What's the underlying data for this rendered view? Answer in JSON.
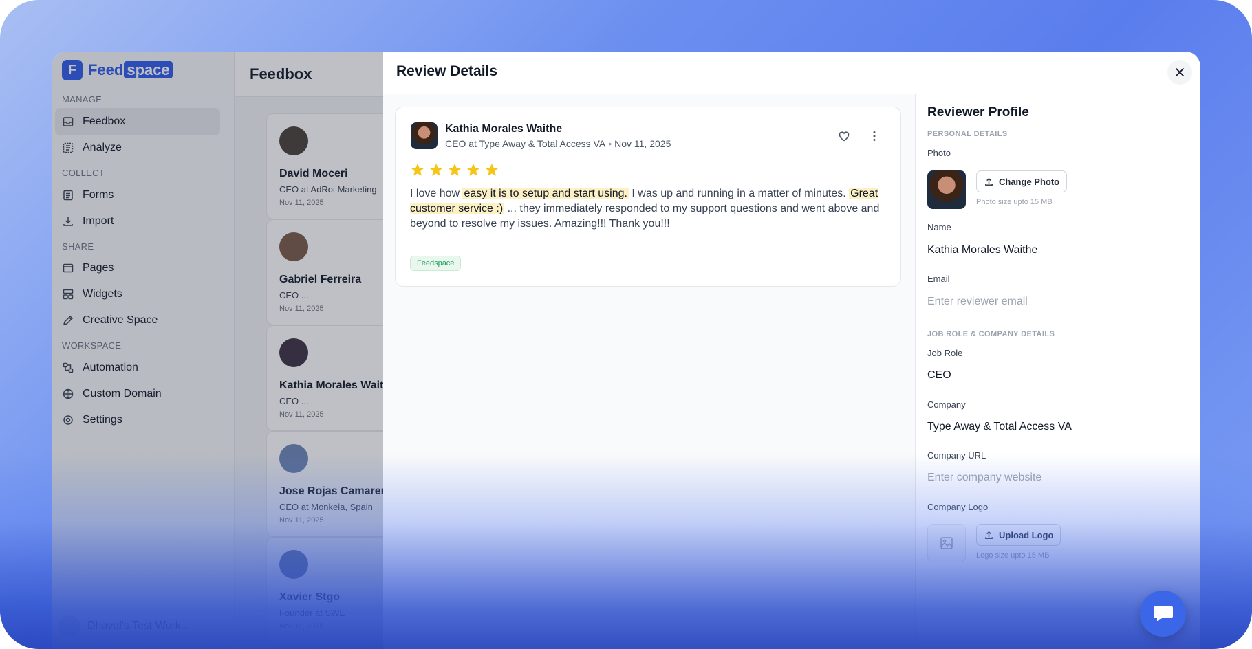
{
  "brand": {
    "logo_letter": "F",
    "name_prefix": "Feed",
    "name_suffix": "space",
    "color": "#2f5bea"
  },
  "sidebar": {
    "sections": [
      {
        "label": "MANAGE",
        "items": [
          {
            "label": "Feedbox",
            "icon": "inbox-icon",
            "active": true
          },
          {
            "label": "Analyze",
            "icon": "analyze-icon"
          }
        ]
      },
      {
        "label": "COLLECT",
        "items": [
          {
            "label": "Forms",
            "icon": "forms-icon"
          },
          {
            "label": "Import",
            "icon": "import-icon"
          }
        ]
      },
      {
        "label": "SHARE",
        "items": [
          {
            "label": "Pages",
            "icon": "pages-icon"
          },
          {
            "label": "Widgets",
            "icon": "widgets-icon"
          },
          {
            "label": "Creative Space",
            "icon": "creative-icon"
          }
        ]
      },
      {
        "label": "WORKSPACE",
        "items": [
          {
            "label": "Automation",
            "icon": "automation-icon"
          },
          {
            "label": "Custom Domain",
            "icon": "globe-icon"
          },
          {
            "label": "Settings",
            "icon": "gear-icon"
          }
        ]
      }
    ],
    "workspace_name": "Dhaval's Test Work..."
  },
  "feedbox": {
    "title": "Feedbox",
    "cards": [
      {
        "name": "David Moceri",
        "role": "CEO at AdRoi Marketing",
        "date": "Nov 11, 2025"
      },
      {
        "name": "Gabriel Ferreira",
        "role": "CEO ...",
        "date": "Nov 11, 2025"
      },
      {
        "name": "Kathia Morales Waithe",
        "role": "CEO ...",
        "date": "Nov 11, 2025"
      },
      {
        "name": "Jose Rojas Camarena",
        "role": "CEO at Monkeia, Spain",
        "date": "Nov 11, 2025"
      },
      {
        "name": "Xavier Stgo",
        "role": "Founder at SWE",
        "date": "Nov 11, 2025"
      }
    ]
  },
  "review": {
    "panel_title": "Review Details",
    "reviewer_name": "Kathia Morales Waithe",
    "reviewer_meta": "CEO at Type Away & Total Access VA",
    "date": "Nov 11, 2025",
    "rating": 5,
    "text_1": "I love how ",
    "highlight_1": "easy it is to setup and start using.",
    "text_2": " I was up and running in a matter of minutes. ",
    "highlight_2": "Great customer service :)",
    "text_3": " ... they immediately responded to my support questions and went above and beyond to resolve my issues. Amazing!!! Thank you!!!",
    "tag": "Feedspace"
  },
  "profile": {
    "title": "Reviewer Profile",
    "personal_section": "PERSONAL DETAILS",
    "photo_label": "Photo",
    "change_photo": "Change Photo",
    "photo_hint": "Photo size upto 15 MB",
    "name_label": "Name",
    "name_value": "Kathia Morales Waithe",
    "email_label": "Email",
    "email_placeholder": "Enter reviewer email",
    "job_section": "JOB ROLE & COMPANY DETAILS",
    "job_label": "Job Role",
    "job_value": "CEO",
    "company_label": "Company",
    "company_value": "Type Away & Total Access VA",
    "company_url_label": "Company URL",
    "company_url_placeholder": "Enter company website",
    "company_logo_label": "Company Logo",
    "upload_logo": "Upload Logo",
    "logo_hint": "Logo size upto 15 MB"
  },
  "colors": {
    "accent": "#2f5bea",
    "star": "#f5c518",
    "highlight": "#fdf1c4",
    "tag_green": "#1f9d57"
  }
}
